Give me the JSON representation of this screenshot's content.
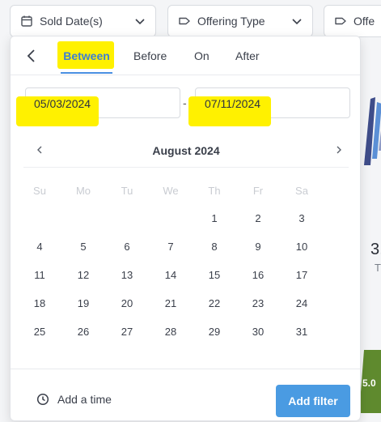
{
  "filters": [
    {
      "label": "Sold Date(s)",
      "icon": "calendar-icon"
    },
    {
      "label": "Offering Type",
      "icon": "tag-icon"
    },
    {
      "label": "Offe",
      "icon": "tag-icon"
    }
  ],
  "background": {
    "number": "3.",
    "sub": "T",
    "percent": "5.0"
  },
  "popup": {
    "tabs": [
      "Between",
      "Before",
      "On",
      "After"
    ],
    "active_tab": "Between",
    "start_date": "05/03/2024",
    "end_date": "07/11/2024",
    "separator": "-",
    "month_title": "August 2024",
    "weekdays": [
      "Su",
      "Mo",
      "Tu",
      "We",
      "Th",
      "Fr",
      "Sa"
    ],
    "weeks": [
      [
        "",
        "",
        "",
        "",
        "1",
        "2",
        "3"
      ],
      [
        "4",
        "5",
        "6",
        "7",
        "8",
        "9",
        "10"
      ],
      [
        "11",
        "12",
        "13",
        "14",
        "15",
        "16",
        "17"
      ],
      [
        "18",
        "19",
        "20",
        "21",
        "22",
        "23",
        "24"
      ],
      [
        "25",
        "26",
        "27",
        "28",
        "29",
        "30",
        "31"
      ]
    ],
    "add_time_label": "Add a time",
    "add_filter_label": "Add filter"
  },
  "colors": {
    "accent": "#4a90e2",
    "highlight": "#fff100",
    "button": "#4a9be2",
    "chart_green": "#5f8a2e",
    "chart_navy": "#3f4d8a"
  }
}
